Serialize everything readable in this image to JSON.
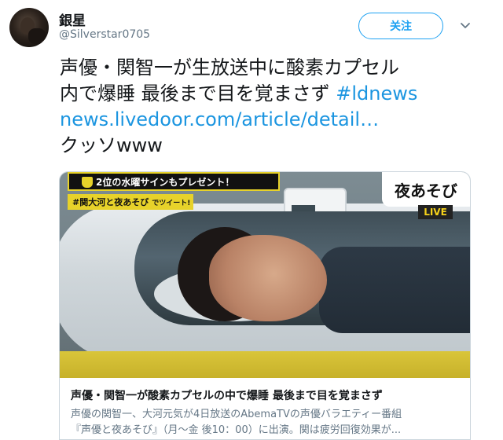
{
  "user": {
    "display_name": "銀星",
    "handle": "@Silverstar0705"
  },
  "actions": {
    "follow_label": "关注",
    "menu_icon": "chevron-down-icon"
  },
  "tweet": {
    "line1": "声優・関智一が生放送中に酸素カプセル",
    "line2_text": "内で爆睡 最後まで目を覚まさず ",
    "hashtag": "#ldnews",
    "link": "news.livedoor.com/article/detail…",
    "line4": "クッソwww"
  },
  "card": {
    "image_overlay": {
      "banner_top": "2位の水曜サインもプレゼント！",
      "banner_hashtag": "#関大河と夜あそび",
      "banner_hashtag_suffix": "でツイート!",
      "show_logo": "夜あそび",
      "live_badge": "LIVE"
    },
    "title": "声優・関智一が酸素カプセルの中で爆睡 最後まで目を覚まさず",
    "description_line1": "声優の関智一、大河元気が4日放送のAbemaTVの声優バラエティー番組",
    "description_line2": "『声優と夜あそび』（月～金 後10：00）に出演。関は疲労回復効果が..."
  },
  "colors": {
    "accent": "#1da1f2",
    "link": "#1b95e0",
    "text": "#14171a",
    "secondary": "#657786",
    "border": "#ccd6dd",
    "overlay_yellow": "#e7d22a"
  }
}
